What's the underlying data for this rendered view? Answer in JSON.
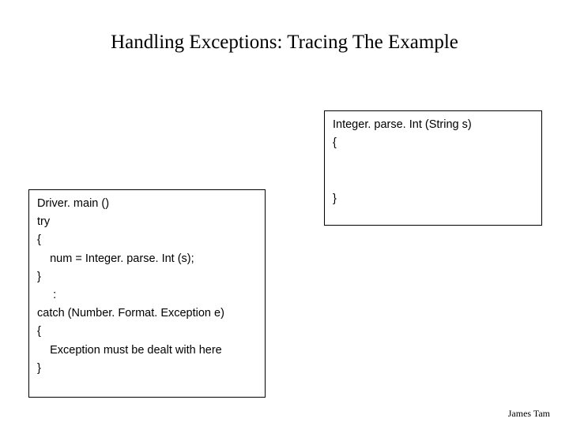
{
  "title": "Handling Exceptions: Tracing The Example",
  "right_box": {
    "header": "Integer. parse. Int (String s)",
    "open_brace": "{",
    "close_brace": "}"
  },
  "left_box": {
    "header": "Driver. main ()",
    "l_try": "try",
    "l_open1": "{",
    "l_body1": "    num = Integer. parse. Int (s);",
    "l_close1": "}",
    "l_colon": "     :",
    "l_catch": "catch (Number. Format. Exception e)",
    "l_open2": "{",
    "l_body2": "    Exception must be dealt with here",
    "l_close2": "}"
  },
  "footer": "James Tam"
}
